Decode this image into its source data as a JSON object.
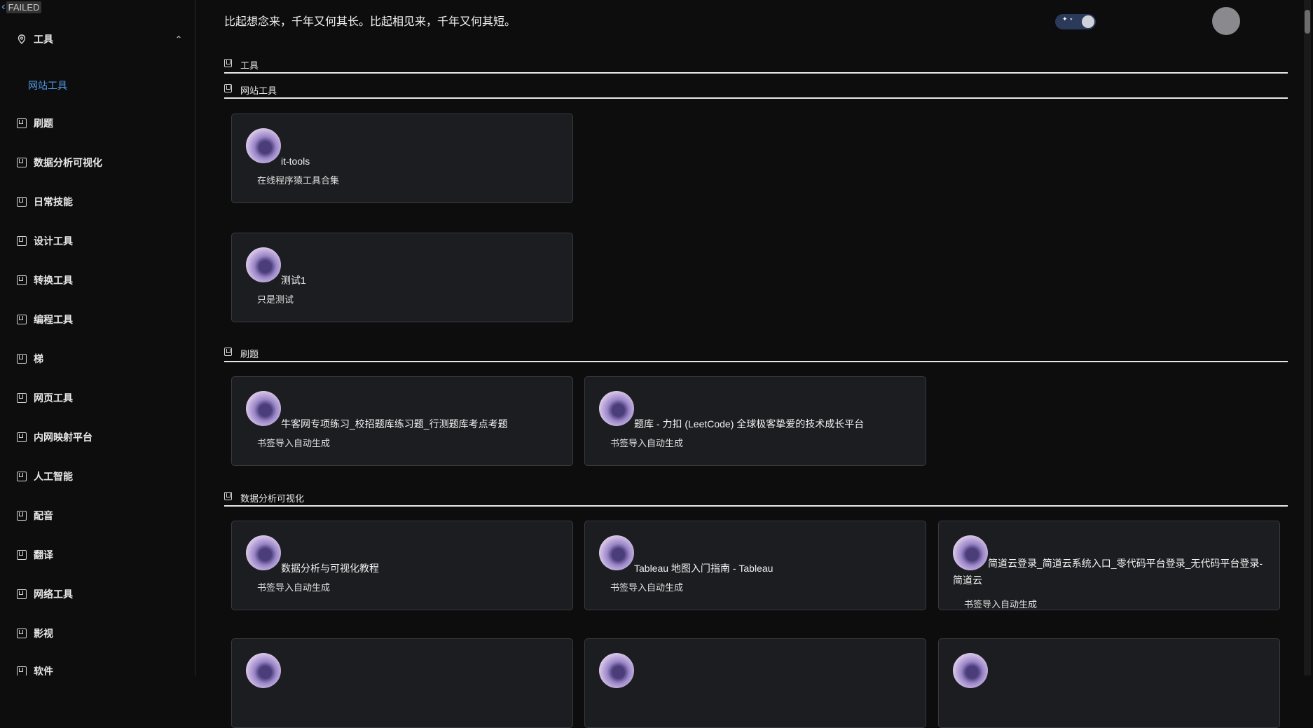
{
  "sidebar": {
    "collapse_label": "FAILED",
    "top": {
      "label": "工具",
      "sub": "网站工具"
    },
    "items": [
      "刷题",
      "数据分析可视化",
      "日常技能",
      "设计工具",
      "转换工具",
      "编程工具",
      "梯",
      "网页工具",
      "内网映射平台",
      "人工智能",
      "配音",
      "翻译",
      "网络工具",
      "影视",
      "软件"
    ]
  },
  "header": {
    "motto": "比起想念来，千年又何其长。比起相见来，千年又何其短。"
  },
  "sections": [
    {
      "title": "工具"
    },
    {
      "title": "网站工具"
    },
    {
      "title": "刷题"
    },
    {
      "title": "数据分析可视化"
    }
  ],
  "cards": [
    {
      "title": "it-tools",
      "desc": "在线程序猿工具合集"
    },
    {
      "title": "测试1",
      "desc": "只是测试"
    },
    {
      "title": "牛客网专项练习_校招题库练习题_行测题库考点考题",
      "desc": "书签导入自动生成"
    },
    {
      "title": "题库 - 力扣 (LeetCode) 全球极客挚爱的技术成长平台",
      "desc": "书签导入自动生成"
    },
    {
      "title": "数据分析与可视化教程",
      "desc": "书签导入自动生成"
    },
    {
      "title": "Tableau 地图入门指南 - Tableau",
      "desc": "书签导入自动生成"
    },
    {
      "title": "简道云登录_简道云系统入口_零代码平台登录_无代码平台登录-简道云",
      "desc": "书签导入自动生成"
    }
  ]
}
